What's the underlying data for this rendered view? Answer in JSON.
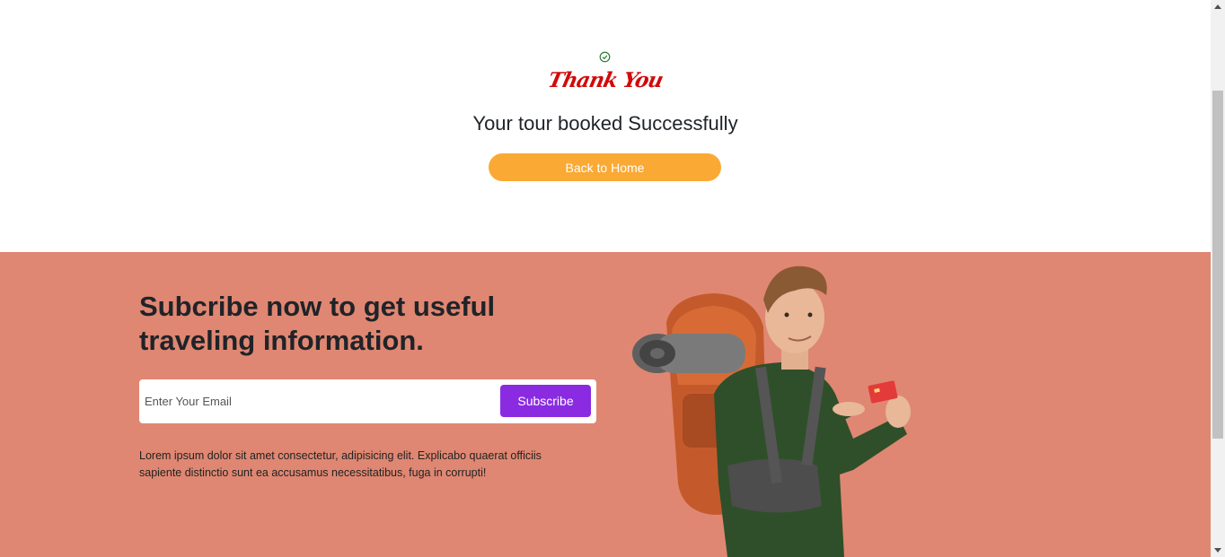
{
  "thank_you": {
    "icon": "check-circle-icon",
    "script_text": "Thank You",
    "title": "Your tour booked Successfully",
    "button_label": "Back to Home"
  },
  "newsletter": {
    "title": "Subcribe now to get useful traveling information.",
    "email_placeholder": "Enter Your Email",
    "subscribe_label": "Subscribe",
    "description": "Lorem ipsum dolor sit amet consectetur, adipisicing elit. Explicabo quaerat officiis sapiente distinctio sunt ea accusamus necessitatibus, fuga in corrupti!",
    "image_icon": "traveler-with-backpack-image"
  },
  "colors": {
    "accent_button": "#faa935",
    "newsletter_bg": "#df8772",
    "subscribe_button": "#8a2be2",
    "thank_you_text": "#d10a0a"
  }
}
